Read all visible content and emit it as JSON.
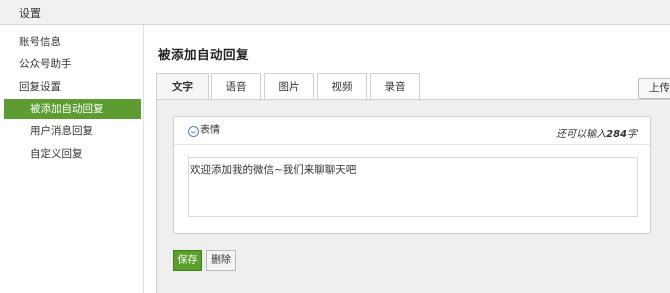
{
  "header": {
    "title": "设置"
  },
  "sidebar": {
    "items": [
      {
        "label": "账号信息"
      },
      {
        "label": "公众号助手"
      },
      {
        "label": "回复设置"
      },
      {
        "label": "被添加自动回复"
      },
      {
        "label": "用户消息回复"
      },
      {
        "label": "自定义回复"
      }
    ]
  },
  "main": {
    "title": "被添加自动回复",
    "tabs": [
      {
        "label": "文字"
      },
      {
        "label": "语音"
      },
      {
        "label": "图片"
      },
      {
        "label": "视频"
      },
      {
        "label": "录音"
      }
    ],
    "upload_label": "上传",
    "editor": {
      "emoji_label": "表情",
      "count_prefix": "还可以输入",
      "count_value": "284",
      "count_suffix": "字",
      "content": "欢迎添加我的微信~我们来聊聊天吧"
    },
    "save_label": "保存",
    "delete_label": "删除"
  },
  "colors": {
    "accent": "#5c9c30",
    "emoji_icon": "#4c86c6"
  }
}
